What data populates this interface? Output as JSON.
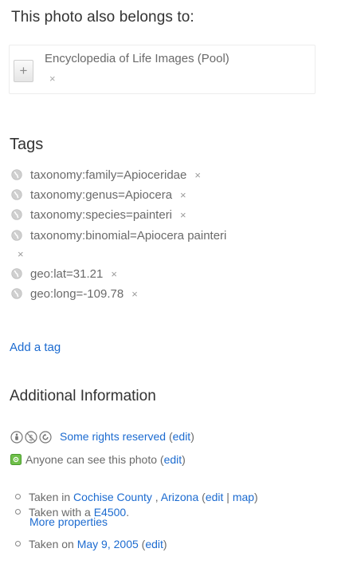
{
  "belongs": {
    "heading": "This photo also belongs to:",
    "pool_name": "Encyclopedia of Life Images (Pool)",
    "add_symbol": "+",
    "remove_symbol": "×"
  },
  "tags": {
    "heading": "Tags",
    "items": [
      {
        "label": "taxonomy:family=Apioceridae"
      },
      {
        "label": "taxonomy:genus=Apiocera"
      },
      {
        "label": "taxonomy:species=painteri"
      },
      {
        "label": "taxonomy:binomial=Apiocera painteri"
      },
      {
        "label": "geo:lat=31.21"
      },
      {
        "label": "geo:long=-109.78"
      }
    ],
    "remove_symbol": "×",
    "add_tag_label": "Add a tag",
    "icon": "globe-icon"
  },
  "additional": {
    "heading": "Additional Information",
    "license_link": "Some rights reserved",
    "edit_label": "edit",
    "open_paren": "(",
    "close_paren": ")",
    "license_icons": [
      "cc-attribution-icon",
      "cc-noncommercial-icon",
      "cc-sharealike-icon"
    ],
    "privacy_text": "Anyone can see this photo",
    "taken_in_prefix": "Taken in",
    "location_county": "Cochise County",
    "location_separator": " ,",
    "location_state": "Arizona",
    "map_label": "map",
    "pipe": "|",
    "taken_with_prefix": "Taken with a",
    "camera": "E4500",
    "period": ".",
    "more_properties": "More properties",
    "taken_on_prefix": "Taken on",
    "taken_date": "May 9, 2005"
  },
  "colors": {
    "link": "#1c6bd0",
    "text": "#6a6a6a",
    "heading": "#333333",
    "privacy_icon": "#5cb85c"
  }
}
